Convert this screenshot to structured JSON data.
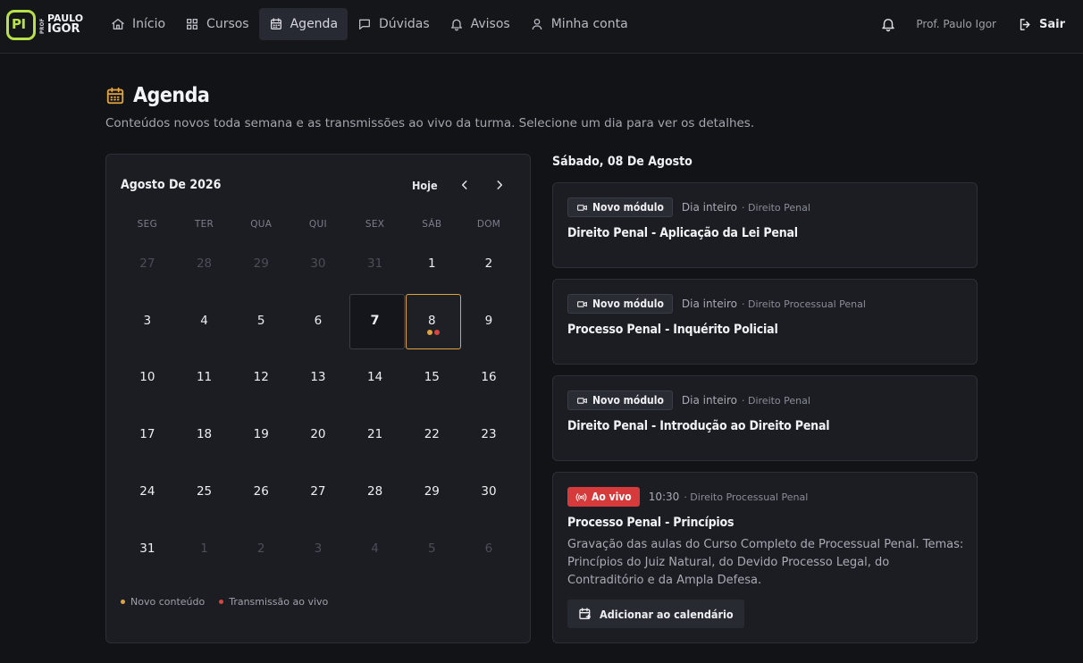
{
  "brand": {
    "badge": "PI",
    "prof": "PROF",
    "name_line1": "PAULO",
    "name_line2": "IGOR",
    "accent": "#b7e04a"
  },
  "nav": {
    "items": [
      {
        "label": "Início",
        "icon": "home-icon"
      },
      {
        "label": "Cursos",
        "icon": "grid-icon"
      },
      {
        "label": "Agenda",
        "icon": "calendar-icon",
        "active": true
      },
      {
        "label": "Dúvidas",
        "icon": "chat-icon"
      },
      {
        "label": "Avisos",
        "icon": "bell-icon"
      },
      {
        "label": "Minha conta",
        "icon": "user-icon"
      }
    ],
    "user_name": "Prof. Paulo Igor",
    "logout_label": "Sair"
  },
  "page": {
    "title": "Agenda",
    "subtitle": "Conteúdos novos toda semana e as transmissões ao vivo da turma. Selecione um dia para ver os detalhes."
  },
  "calendar": {
    "month_label": "Agosto De 2026",
    "today_label": "Hoje",
    "weekdays": [
      "SEG",
      "TER",
      "QUA",
      "QUI",
      "SEX",
      "SÁB",
      "DOM"
    ],
    "days": [
      {
        "n": "27",
        "muted": true
      },
      {
        "n": "28",
        "muted": true
      },
      {
        "n": "29",
        "muted": true
      },
      {
        "n": "30",
        "muted": true
      },
      {
        "n": "31",
        "muted": true
      },
      {
        "n": "1"
      },
      {
        "n": "2"
      },
      {
        "n": "3"
      },
      {
        "n": "4"
      },
      {
        "n": "5"
      },
      {
        "n": "6"
      },
      {
        "n": "7",
        "today": true
      },
      {
        "n": "8",
        "selected": true,
        "dots": [
          "#e0a340",
          "#d9453f"
        ]
      },
      {
        "n": "9"
      },
      {
        "n": "10"
      },
      {
        "n": "11"
      },
      {
        "n": "12"
      },
      {
        "n": "13"
      },
      {
        "n": "14"
      },
      {
        "n": "15"
      },
      {
        "n": "16"
      },
      {
        "n": "17"
      },
      {
        "n": "18"
      },
      {
        "n": "19"
      },
      {
        "n": "20"
      },
      {
        "n": "21"
      },
      {
        "n": "22"
      },
      {
        "n": "23"
      },
      {
        "n": "24"
      },
      {
        "n": "25"
      },
      {
        "n": "26"
      },
      {
        "n": "27"
      },
      {
        "n": "28"
      },
      {
        "n": "29"
      },
      {
        "n": "30"
      },
      {
        "n": "31"
      },
      {
        "n": "1",
        "muted": true
      },
      {
        "n": "2",
        "muted": true
      },
      {
        "n": "3",
        "muted": true
      },
      {
        "n": "4",
        "muted": true
      },
      {
        "n": "5",
        "muted": true
      },
      {
        "n": "6",
        "muted": true
      }
    ],
    "legend": [
      {
        "label": "Novo conteúdo",
        "color": "#e0a340"
      },
      {
        "label": "Transmissão ao vivo",
        "color": "#d9453f"
      }
    ]
  },
  "details": {
    "date_heading": "Sábado, 08 De Agosto",
    "events": [
      {
        "badge": "Novo módulo",
        "badge_type": "module",
        "time": "Dia inteiro",
        "category": "· Direito Penal",
        "title": "Direito Penal - Aplicação da Lei Penal"
      },
      {
        "badge": "Novo módulo",
        "badge_type": "module",
        "time": "Dia inteiro",
        "category": "· Direito Processual Penal",
        "title": "Processo Penal - Inquérito Policial"
      },
      {
        "badge": "Novo módulo",
        "badge_type": "module",
        "time": "Dia inteiro",
        "category": "· Direito Penal",
        "title": "Direito Penal - Introdução ao Direito Penal"
      },
      {
        "badge": "Ao vivo",
        "badge_type": "live",
        "time": "10:30",
        "category": "· Direito Processual Penal",
        "title": "Processo Penal - Princípios",
        "description": "Gravação das aulas do Curso Completo de Processual Penal. Temas: Princípios do Juiz Natural, do Devido Processo Legal, do Contraditório e da Ampla Defesa.",
        "action": "Adicionar ao calendário"
      }
    ]
  },
  "colors": {
    "background": "#121317",
    "card": "#1b1d23",
    "selected_border": "#e0a340",
    "live": "#d73a3a"
  }
}
